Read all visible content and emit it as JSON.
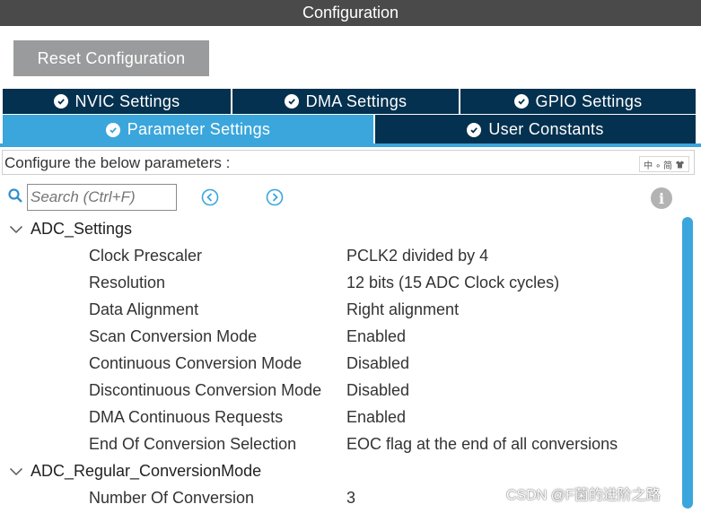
{
  "window": {
    "title": "Configuration"
  },
  "toolbar": {
    "reset_label": "Reset Configuration"
  },
  "tabs": {
    "row1": [
      {
        "label": "NVIC Settings"
      },
      {
        "label": "DMA Settings"
      },
      {
        "label": "GPIO Settings"
      }
    ],
    "row2": [
      {
        "label": "Parameter Settings",
        "active": true
      },
      {
        "label": "User Constants"
      }
    ]
  },
  "config": {
    "prompt": "Configure the below parameters :",
    "ime_text": "中 ∘ 简"
  },
  "search": {
    "placeholder": "Search (Ctrl+F)"
  },
  "groups": [
    {
      "name": "ADC_Settings",
      "params": [
        {
          "label": "Clock Prescaler",
          "value": "PCLK2 divided by 4"
        },
        {
          "label": "Resolution",
          "value": "12 bits (15 ADC Clock cycles)"
        },
        {
          "label": "Data Alignment",
          "value": "Right alignment"
        },
        {
          "label": "Scan Conversion Mode",
          "value": "Enabled"
        },
        {
          "label": "Continuous Conversion Mode",
          "value": "Disabled"
        },
        {
          "label": "Discontinuous Conversion Mode",
          "value": "Disabled"
        },
        {
          "label": "DMA Continuous Requests",
          "value": "Enabled"
        },
        {
          "label": "End Of Conversion Selection",
          "value": "EOC flag at the end of all conversions"
        }
      ]
    },
    {
      "name": "ADC_Regular_ConversionMode",
      "params": [
        {
          "label": "Number Of Conversion",
          "value": "3"
        }
      ]
    }
  ],
  "watermark": "CSDN @F菌的进阶之路",
  "colors": {
    "accent": "#3aa6dc",
    "tab_dark": "#04314f",
    "titlebar": "#4a4a4a",
    "button": "#9a9b9c"
  }
}
